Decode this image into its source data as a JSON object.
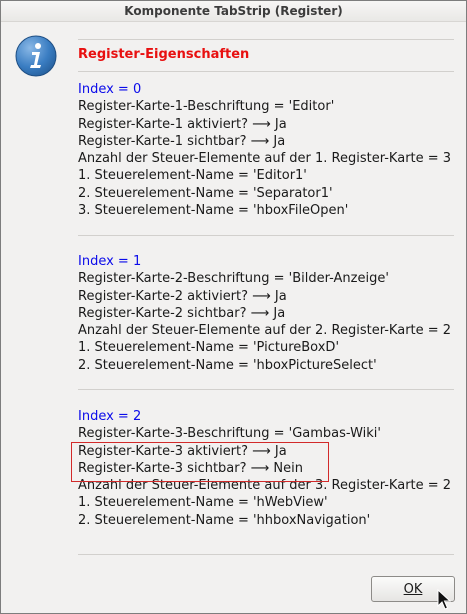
{
  "window": {
    "title": "Komponente TabStrip (Register)"
  },
  "dialog": {
    "heading": "Register-Eigenschaften",
    "sections": [
      {
        "index": "Index = 0",
        "lines": [
          "Register-Karte-1-Beschriftung = 'Editor'",
          "Register-Karte-1 aktiviert? ⟶ Ja",
          "Register-Karte-1 sichtbar? ⟶ Ja",
          "Anzahl der Steuer-Elemente auf der 1. Register-Karte = 3",
          "1. Steuerelement-Name = 'Editor1'",
          "2. Steuerelement-Name = 'Separator1'",
          "3. Steuerelement-Name = 'hboxFileOpen'"
        ]
      },
      {
        "index": "Index = 1",
        "lines": [
          "Register-Karte-2-Beschriftung = 'Bilder-Anzeige'",
          "Register-Karte-2 aktiviert? ⟶ Ja",
          "Register-Karte-2 sichtbar? ⟶ Ja",
          "Anzahl der Steuer-Elemente auf der 2. Register-Karte = 2",
          "1. Steuerelement-Name = 'PictureBoxD'",
          "2. Steuerelement-Name = 'hboxPictureSelect'"
        ]
      },
      {
        "index": "Index = 2",
        "lines": [
          "Register-Karte-3-Beschriftung = 'Gambas-Wiki'",
          "Register-Karte-3 aktiviert? ⟶ Ja",
          "Register-Karte-3 sichtbar? ⟶ Nein",
          "Anzahl der Steuer-Elemente auf der 3. Register-Karte = 2",
          "1. Steuerelement-Name = 'hWebView'",
          "2. Steuerelement-Name = 'hhboxNavigation'"
        ]
      }
    ],
    "ok_label": "OK"
  },
  "icons": {
    "info": "info-icon",
    "cursor": "mouse-pointer-icon"
  },
  "colors": {
    "heading": "#e81010",
    "index": "#0b0bea",
    "highlight_box": "#d22a2a",
    "icon_blue": "#2f73b8"
  }
}
